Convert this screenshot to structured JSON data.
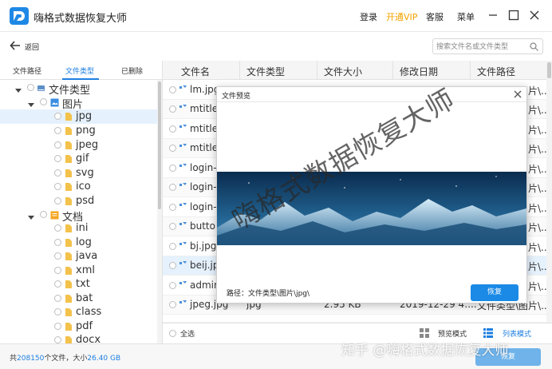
{
  "app": {
    "title": "嗨格式数据恢复大师",
    "menu": {
      "login": "登录",
      "vip": "开通VIP",
      "service": "客服",
      "menu": "菜单"
    }
  },
  "toolbar": {
    "back_label": "返回",
    "search_placeholder": "搜索文件名或文件类型"
  },
  "left_tabs": [
    {
      "label": "文件路径",
      "active": false
    },
    {
      "label": "文件类型",
      "active": true
    },
    {
      "label": "已删除",
      "active": false
    }
  ],
  "tree": [
    {
      "label": "文件类型",
      "level": 0,
      "expanded": true,
      "icon": "drive-icon"
    },
    {
      "label": "图片",
      "level": 1,
      "expanded": true,
      "icon": "image-folder-icon"
    },
    {
      "label": "jpg",
      "level": 2,
      "selected": true,
      "icon": "folder-icon"
    },
    {
      "label": "png",
      "level": 2,
      "icon": "folder-icon"
    },
    {
      "label": "jpeg",
      "level": 2,
      "icon": "folder-icon"
    },
    {
      "label": "gif",
      "level": 2,
      "icon": "folder-icon"
    },
    {
      "label": "svg",
      "level": 2,
      "icon": "folder-icon"
    },
    {
      "label": "ico",
      "level": 2,
      "icon": "folder-icon"
    },
    {
      "label": "psd",
      "level": 2,
      "icon": "folder-icon"
    },
    {
      "label": "文档",
      "level": 1,
      "expanded": true,
      "icon": "document-folder-icon"
    },
    {
      "label": "ini",
      "level": 2,
      "icon": "folder-icon"
    },
    {
      "label": "log",
      "level": 2,
      "icon": "folder-icon"
    },
    {
      "label": "java",
      "level": 2,
      "icon": "folder-icon"
    },
    {
      "label": "xml",
      "level": 2,
      "icon": "folder-icon"
    },
    {
      "label": "txt",
      "level": 2,
      "icon": "folder-icon"
    },
    {
      "label": "bat",
      "level": 2,
      "icon": "folder-icon"
    },
    {
      "label": "class",
      "level": 2,
      "icon": "folder-icon"
    },
    {
      "label": "pdf",
      "level": 2,
      "icon": "folder-icon"
    },
    {
      "label": "docx",
      "level": 2,
      "icon": "folder-icon"
    }
  ],
  "table": {
    "columns": [
      "文件名",
      "文件类型",
      "文件大小",
      "修改日期",
      "文件路径"
    ],
    "rows": [
      {
        "name": "lm.jpg",
        "type": "",
        "size": "",
        "date": "",
        "path": "片\\..."
      },
      {
        "name": "mtitle",
        "type": "",
        "size": "",
        "date": "",
        "path": "片\\..."
      },
      {
        "name": "mtitle",
        "type": "",
        "size": "",
        "date": "",
        "path": "片\\..."
      },
      {
        "name": "mtitle",
        "type": "",
        "size": "",
        "date": "",
        "path": "片\\..."
      },
      {
        "name": "login-",
        "type": "",
        "size": "",
        "date": "",
        "path": "片\\..."
      },
      {
        "name": "login-",
        "type": "",
        "size": "",
        "date": "",
        "path": "片\\..."
      },
      {
        "name": "login-",
        "type": "",
        "size": "",
        "date": "",
        "path": "片\\..."
      },
      {
        "name": "buttor",
        "type": "",
        "size": "",
        "date": "",
        "path": "片\\..."
      },
      {
        "name": "bj.jpg",
        "type": "",
        "size": "",
        "date": "",
        "path": "片\\..."
      },
      {
        "name": "beij.jpg",
        "type": "",
        "size": "",
        "date": "",
        "path": "片\\...",
        "selected": true
      },
      {
        "name": "admin",
        "type": "",
        "size": "",
        "date": "",
        "path": "片\\..."
      },
      {
        "name": "jpeg.jpg",
        "type": "jpg",
        "size": "2.95 KB",
        "date": "2019-12-29 4:...",
        "path": "文件类型\\图片\\..."
      },
      {
        "name": "",
        "type": "",
        "size": "",
        "date": "",
        "path": ""
      }
    ]
  },
  "bottom": {
    "select_all": "全选",
    "preview_mode": "预览模式",
    "list_mode": "列表模式"
  },
  "status": {
    "prefix": "共",
    "count": "208150",
    "middle": "个文件，大小",
    "size": "26.40 GB",
    "recover": "恢复"
  },
  "dialog": {
    "title": "文件预览",
    "path_label": "路径：",
    "path_value": "文件类型\\图片\\jpg\\",
    "recover": "恢复"
  },
  "watermark": {
    "diagonal": "嗨格式数据恢复大师",
    "zhihu": "知乎 @嗨格式数据恢复大师"
  },
  "colors": {
    "accent": "#1e7fe0",
    "vip": "#f5a200",
    "button": "#1a8ae6",
    "selected_row": "#e5f1fd"
  }
}
